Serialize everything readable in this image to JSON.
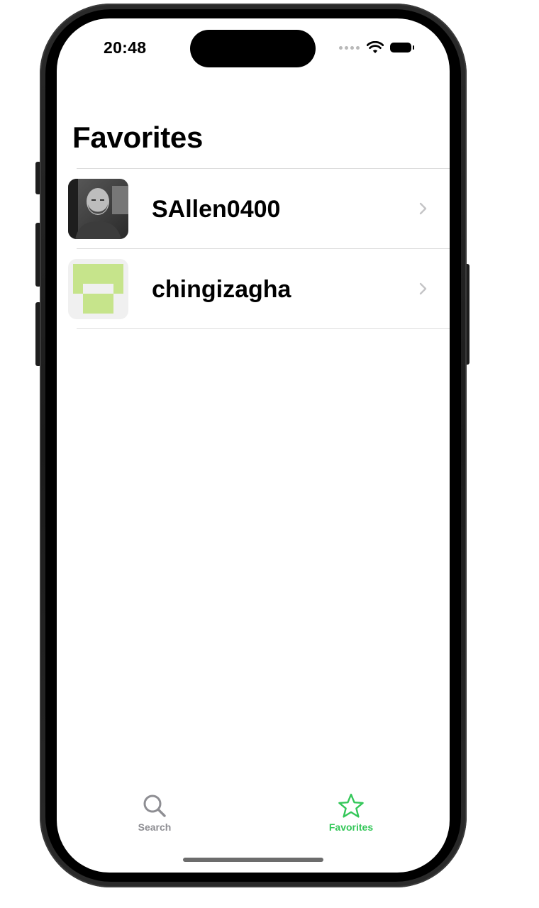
{
  "status_bar": {
    "time": "20:48"
  },
  "nav": {
    "title": "Favorites"
  },
  "favorites": [
    {
      "username": "SAllen0400",
      "avatar": "photo-avatar"
    },
    {
      "username": "chingizagha",
      "avatar": "identicon-avatar"
    }
  ],
  "tab_bar": {
    "tabs": [
      {
        "label": "Search",
        "icon": "search-icon",
        "selected": false
      },
      {
        "label": "Favorites",
        "icon": "star-icon",
        "selected": true
      }
    ]
  },
  "colors": {
    "accent": "#34c759",
    "inactive_tab": "#8e8e93",
    "identicon_fill": "#c6e48b",
    "identicon_bg": "#f0f0f0",
    "chevron": "#c4c4c6"
  }
}
